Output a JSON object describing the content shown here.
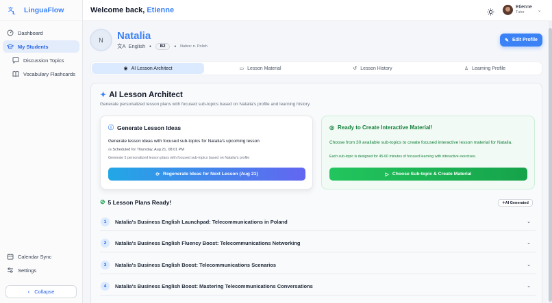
{
  "app": {
    "name": "LinguaFlow"
  },
  "sidebar": {
    "items": [
      {
        "label": "Dashboard",
        "icon": "gauge-icon"
      },
      {
        "label": "My Students",
        "icon": "graduation-cap-icon"
      },
      {
        "label": "Discussion Topics",
        "icon": "chat-bubble-icon"
      },
      {
        "label": "Vocabulary Flashcards",
        "icon": "book-icon"
      }
    ],
    "bottom_items": [
      {
        "label": "Calendar Sync",
        "icon": "calendar-icon"
      },
      {
        "label": "Settings",
        "icon": "sliders-icon"
      }
    ],
    "collapse_label": "Collapse"
  },
  "header": {
    "welcome_prefix": "Welcome back, ",
    "user_first_name": "Etienne",
    "user_name": "Etienne",
    "user_role": "Tutor"
  },
  "student": {
    "initial": "N",
    "name": "Natalia",
    "language": "English",
    "level": "B2",
    "native": "Native: n. Polish",
    "edit_label": "Edit Profile"
  },
  "tabs": [
    {
      "label": "AI Lesson Architect",
      "icon": "brain-icon"
    },
    {
      "label": "Lesson Material",
      "icon": "open-book-icon"
    },
    {
      "label": "Lesson History",
      "icon": "history-icon"
    },
    {
      "label": "Learning Profile",
      "icon": "user-icon"
    }
  ],
  "architect": {
    "title": "AI Lesson Architect",
    "subtitle": "Generate personalized lesson plans with focused sub-topics based on Natalia's profile and learning history"
  },
  "generate_card": {
    "title": "Generate Lesson Ideas",
    "text": "Generate lesson ideas with focused sub-topics for Natalia's upcoming lesson",
    "scheduled": "Scheduled for Thursday, Aug 21, 08:01 PM",
    "note": "Generate 5 personalized lesson plans with focused sub-topics based on Natalia's profile",
    "button": "Regenerate Ideas for Next Lesson (Aug 21)"
  },
  "ready_card": {
    "title": "Ready to Create Interactive Material!",
    "text": "Choose from 30 available sub-topics to create focused interactive lesson material for Natalia.",
    "note": "Each sub-topic is designed for 45-60 minutes of focused learning with interactive exercises.",
    "button": "Choose Sub-topic & Create Material"
  },
  "plans": {
    "title": "5 Lesson Plans Ready!",
    "badge": "AI Generated",
    "items": [
      {
        "num": "1",
        "title": "Natalia's Business English Launchpad: Telecommunications in Poland"
      },
      {
        "num": "2",
        "title": "Natalia's Business English Fluency Boost: Telecommunications Networking"
      },
      {
        "num": "3",
        "title": "Natalia's Business English Boost: Telecommunications Scenarios"
      },
      {
        "num": "4",
        "title": "Natalia's Business English Boost: Mastering Telecommunications Conversations"
      }
    ]
  }
}
